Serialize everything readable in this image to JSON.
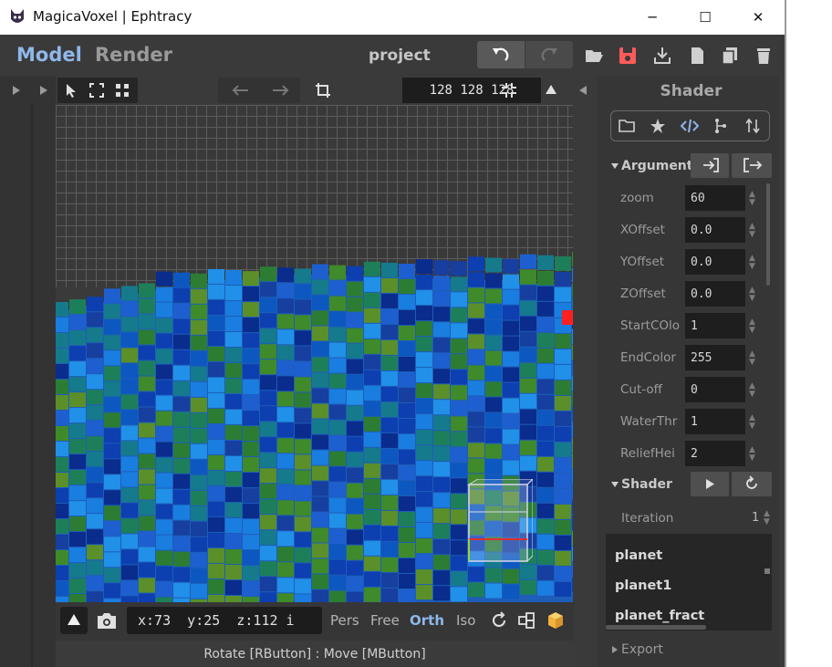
{
  "window": {
    "title": "MagicaVoxel | Ephtracy",
    "controls": {
      "minimize": "─",
      "maximize": "☐",
      "close": "✕"
    }
  },
  "topbar": {
    "tab_model": "Model",
    "tab_render": "Render",
    "project_name": "project",
    "icons": [
      "undo-icon",
      "redo-icon",
      "open-folder-icon",
      "save-icon",
      "export-icon",
      "new-file-icon",
      "copy-icon",
      "delete-icon"
    ]
  },
  "viewport_toolbar": {
    "dims": "128 128 128"
  },
  "bottombar": {
    "coords": "x:73  y:25  z:112 i",
    "views": [
      "Pers",
      "Free",
      "Orth",
      "Iso"
    ],
    "active_view": "Orth"
  },
  "status": "Rotate [RButton] : Move [MButton]",
  "panel": {
    "title": "Shader",
    "argument_label": "Argument",
    "arguments": [
      {
        "label": "zoom",
        "value": "60"
      },
      {
        "label": "XOffset",
        "value": "0.0"
      },
      {
        "label": "YOffset",
        "value": "0.0"
      },
      {
        "label": "ZOffset",
        "value": "0.0"
      },
      {
        "label": "StartCOlo",
        "value": "1"
      },
      {
        "label": "EndColor",
        "value": "255"
      },
      {
        "label": "Cut-off",
        "value": "0"
      },
      {
        "label": "WaterThr",
        "value": "1"
      },
      {
        "label": "ReliefHei",
        "value": "2"
      }
    ],
    "shader_label": "Shader",
    "iteration_label": "Iteration",
    "iteration_value": "1",
    "shader_list": [
      "planet",
      "planet1",
      "planet_fract"
    ],
    "export_label": "Export"
  },
  "colors": {
    "accent": "#8fb8e8",
    "save_red": "#ff5a5a",
    "cube_yellow": "#f3b33d"
  }
}
